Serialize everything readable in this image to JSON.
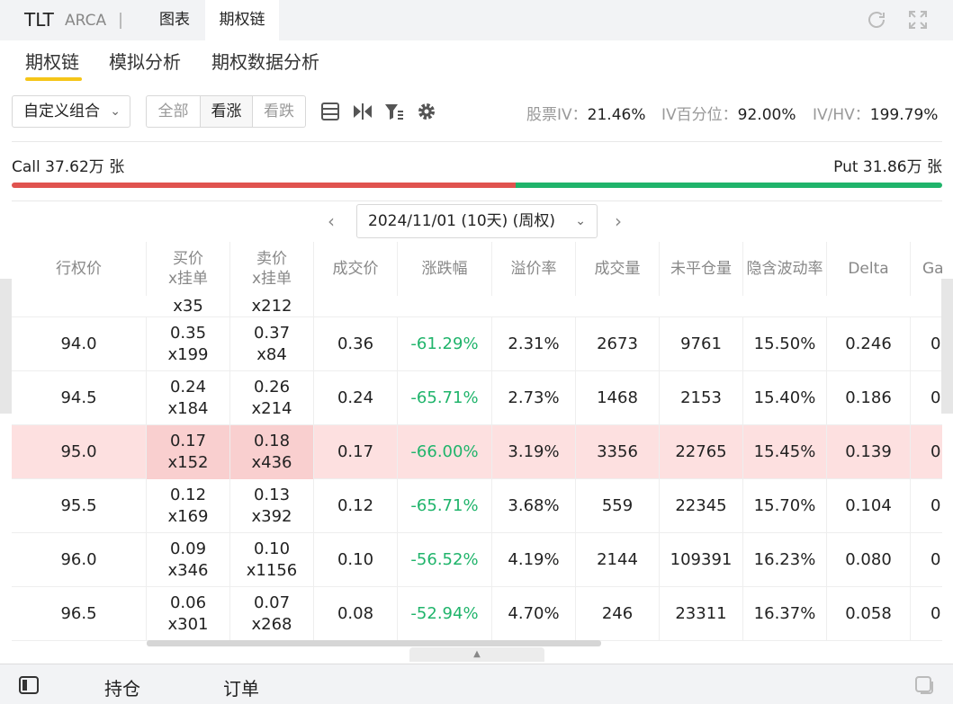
{
  "header": {
    "ticker": "TLT",
    "exchange": "ARCA",
    "tabs": [
      {
        "label": "图表"
      },
      {
        "label": "期权链"
      }
    ],
    "active_tab": "期权链"
  },
  "subtabs": [
    {
      "label": "期权链"
    },
    {
      "label": "模拟分析"
    },
    {
      "label": "期权数据分析"
    }
  ],
  "toolbar": {
    "combo_value": "自定义组合",
    "filter_all": "全部",
    "filter_call": "看涨",
    "filter_put": "看跌",
    "stock_iv_label": "股票IV：",
    "stock_iv_value": "21.46%",
    "iv_pct_label": "IV百分位：",
    "iv_pct_value": "92.00%",
    "ivhv_label": "IV/HV：",
    "ivhv_value": "199.79%"
  },
  "volume": {
    "call_label": "Call 37.62万 张",
    "put_label": "Put 31.86万 张",
    "call_fraction": 0.5415
  },
  "expiry": {
    "selected": "2024/11/01 (10天) (周权)"
  },
  "table": {
    "headers": [
      {
        "l1": "行权价",
        "l2": ""
      },
      {
        "l1": "买价",
        "l2": "x挂单"
      },
      {
        "l1": "卖价",
        "l2": "x挂单"
      },
      {
        "l1": "成交价",
        "l2": ""
      },
      {
        "l1": "涨跌幅",
        "l2": ""
      },
      {
        "l1": "溢价率",
        "l2": ""
      },
      {
        "l1": "成交量",
        "l2": ""
      },
      {
        "l1": "未平仓量",
        "l2": ""
      },
      {
        "l1": "隐含波动率",
        "l2": ""
      },
      {
        "l1": "Delta",
        "l2": ""
      },
      {
        "l1": "Ga",
        "l2": ""
      }
    ],
    "partial_row": {
      "bid_size": "x35",
      "ask_size": "x212"
    },
    "rows": [
      {
        "strike": "94.0",
        "bid": "0.35",
        "bid_size": "x199",
        "ask": "0.37",
        "ask_size": "x84",
        "last": "0.36",
        "change": "-61.29%",
        "premium": "2.31%",
        "volume": "2673",
        "oi": "9761",
        "iv": "15.50%",
        "delta": "0.246",
        "gamma": "0."
      },
      {
        "strike": "94.5",
        "bid": "0.24",
        "bid_size": "x184",
        "ask": "0.26",
        "ask_size": "x214",
        "last": "0.24",
        "change": "-65.71%",
        "premium": "2.73%",
        "volume": "1468",
        "oi": "2153",
        "iv": "15.40%",
        "delta": "0.186",
        "gamma": "0"
      },
      {
        "strike": "95.0",
        "bid": "0.17",
        "bid_size": "x152",
        "ask": "0.18",
        "ask_size": "x436",
        "last": "0.17",
        "change": "-66.00%",
        "premium": "3.19%",
        "volume": "3356",
        "oi": "22765",
        "iv": "15.45%",
        "delta": "0.139",
        "gamma": "0"
      },
      {
        "strike": "95.5",
        "bid": "0.12",
        "bid_size": "x169",
        "ask": "0.13",
        "ask_size": "x392",
        "last": "0.12",
        "change": "-65.71%",
        "premium": "3.68%",
        "volume": "559",
        "oi": "22345",
        "iv": "15.70%",
        "delta": "0.104",
        "gamma": "0"
      },
      {
        "strike": "96.0",
        "bid": "0.09",
        "bid_size": "x346",
        "ask": "0.10",
        "ask_size": "x1156",
        "last": "0.10",
        "change": "-56.52%",
        "premium": "4.19%",
        "volume": "2144",
        "oi": "109391",
        "iv": "16.23%",
        "delta": "0.080",
        "gamma": "0."
      },
      {
        "strike": "96.5",
        "bid": "0.06",
        "bid_size": "x301",
        "ask": "0.07",
        "ask_size": "x268",
        "last": "0.08",
        "change": "-52.94%",
        "premium": "4.70%",
        "volume": "246",
        "oi": "23311",
        "iv": "16.37%",
        "delta": "0.058",
        "gamma": "0."
      }
    ]
  },
  "bottom": {
    "tabs": [
      {
        "label": "持仓"
      },
      {
        "label": "订单"
      }
    ]
  },
  "colors": {
    "call": "#e0534f",
    "put": "#20b46b",
    "accent": "#f5c518",
    "highlight_row": "#fde0e0"
  }
}
